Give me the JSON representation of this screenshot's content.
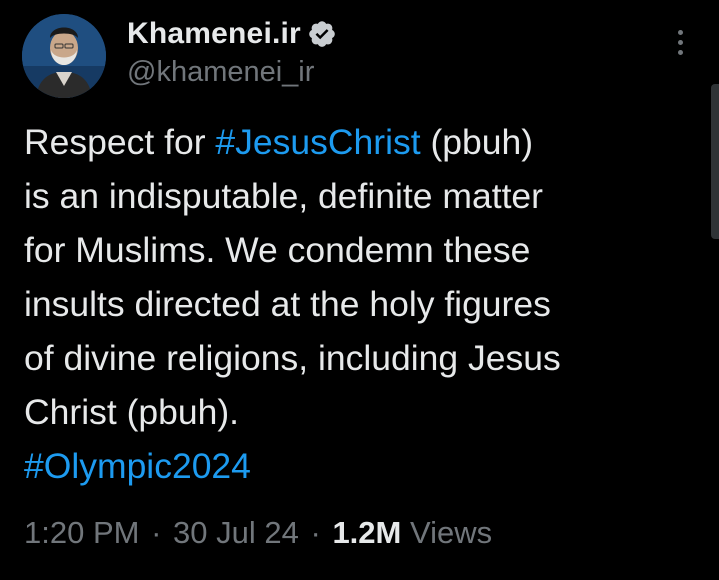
{
  "author": {
    "display_name": "Khamenei.ir",
    "handle": "@khamenei_ir",
    "verified": true,
    "avatar_icon": "profile-photo"
  },
  "tweet": {
    "lines": [
      [
        {
          "text": "Respect for "
        },
        {
          "text": "#JesusChrist",
          "hashtag": true
        },
        {
          "text": " (pbuh)"
        }
      ],
      [
        {
          "text": "is an indisputable, definite matter"
        }
      ],
      [
        {
          "text": "for Muslims. We condemn these"
        }
      ],
      [
        {
          "text": "insults directed at the holy figures"
        }
      ],
      [
        {
          "text": "of divine religions, including Jesus"
        }
      ],
      [
        {
          "text": "Christ (pbuh)."
        }
      ],
      [
        {
          "text": "#Olympic2024",
          "hashtag": true
        }
      ]
    ]
  },
  "meta": {
    "time": "1:20 PM",
    "separator": "·",
    "date": "30 Jul 24",
    "views_count": "1.2M",
    "views_label": "Views"
  },
  "colors": {
    "background": "#000000",
    "text": "#e7e9ea",
    "secondary": "#71767b",
    "link": "#1d9bf0"
  }
}
